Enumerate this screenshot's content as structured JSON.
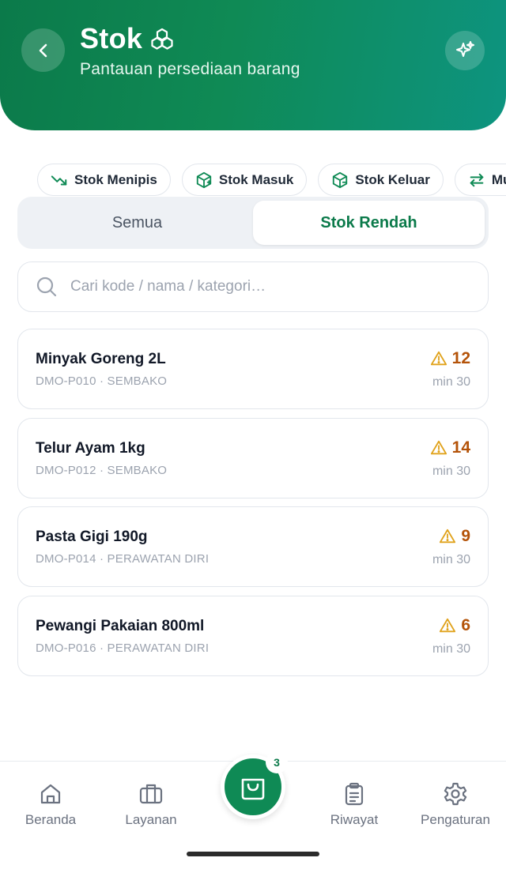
{
  "header": {
    "title": "Stok",
    "subtitle": "Pantauan persediaan barang",
    "title_icon": "cubes-icon",
    "back_icon": "chevron-left-icon",
    "action_icon": "sparkle-icon",
    "gradient_start": "#0b7a4a",
    "gradient_end": "#0d9480"
  },
  "chips": [
    {
      "label": "Stok Menipis",
      "icon": "trend-down-icon"
    },
    {
      "label": "Stok Masuk",
      "icon": "box-in-icon"
    },
    {
      "label": "Stok Keluar",
      "icon": "box-out-icon"
    },
    {
      "label": "Mu",
      "icon": "transfer-icon"
    }
  ],
  "tabs": {
    "all_label": "Semua",
    "low_label": "Stok Rendah",
    "active": "Stok Rendah"
  },
  "search": {
    "placeholder": "Cari kode / nama / kategori…",
    "value": ""
  },
  "items": [
    {
      "name": "Minyak Goreng 2L",
      "meta": "DMO-P010 · SEMBAKO",
      "qty": "12",
      "min": "min 30"
    },
    {
      "name": "Telur Ayam 1kg",
      "meta": "DMO-P012 · SEMBAKO",
      "qty": "14",
      "min": "min 30"
    },
    {
      "name": "Pasta Gigi 190g",
      "meta": "DMO-P014 · PERAWATAN DIRI",
      "qty": "9",
      "min": "min 30"
    },
    {
      "name": "Pewangi Pakaian 800ml",
      "meta": "DMO-P016 · PERAWATAN DIRI",
      "qty": "6",
      "min": "min 30"
    }
  ],
  "bottom_nav": {
    "home": "Beranda",
    "services": "Layanan",
    "history": "Riwayat",
    "settings": "Pengaturan",
    "cart_badge": "3"
  },
  "colors": {
    "brand": "#0f8a55",
    "warning_icon": "#e0a21b",
    "warning_text": "#b45309"
  }
}
